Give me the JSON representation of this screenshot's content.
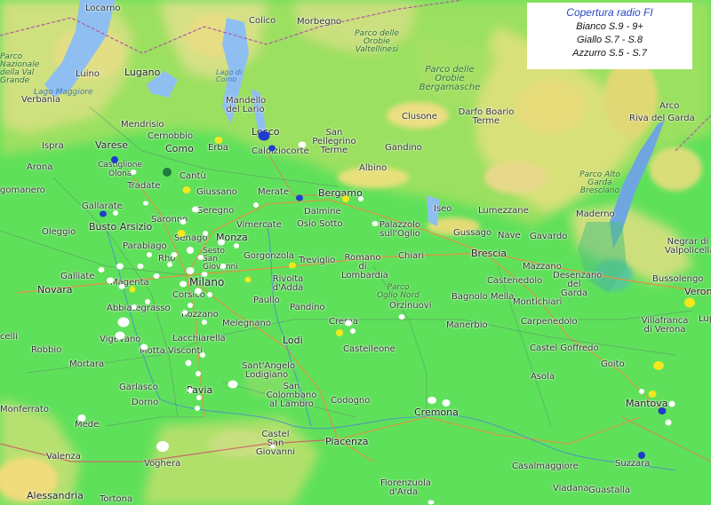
{
  "legend": {
    "title": "Copertura radio FI",
    "rows": [
      "Bianco S.9 - 9+",
      "Giallo  S.7 - S.8",
      "Azzurro S.5 - S.7"
    ]
  },
  "colors": {
    "coverage_base": "#5fe05a",
    "white_dot": "#ffffff",
    "yellow_dot": "#f3e71d",
    "blue_dot": "#1f3ccc",
    "lake": "#8fbff0"
  },
  "places": {
    "locarno": "Locarno",
    "lugano": "Lugano",
    "luino": "Luino",
    "verbania": "Verbania",
    "lago_maggiore": "Lago Maggiore",
    "parco_valgrande": "Parco Nazionale della Val Grande",
    "colico": "Colico",
    "morbegno": "Morbegno",
    "parco_orobie_valtellinesi": "Parco delle Orobie Valtellinesi",
    "parco_orobie_bergamasche": "Parco delle Orobie Bergamasche",
    "lago_como": "Lago di Como",
    "mandello": "Mandello del Lario",
    "mendrisio": "Mendrisio",
    "cernobbio": "Cernobbio",
    "como": "Como",
    "erba": "Erba",
    "lecco": "Lecco",
    "calolziocorte": "Calolziocorte",
    "san_pellegrino": "San Pellegrino Terme",
    "clusone": "Clusone",
    "darfo": "Darfo Boario Terme",
    "arco": "Arco",
    "riva": "Riva del Garda",
    "parco_alto_garda": "Parco Alto Garda Bresciano",
    "ispra": "Ispra",
    "varese": "Varese",
    "castiglione": "Castiglione",
    "arona": "Arona",
    "olona": "Olona",
    "tradate": "Tradate",
    "cantu": "Cantù",
    "giussano": "Giussano",
    "merate": "Merate",
    "bergamo": "Bergamo",
    "gandino": "Gandino",
    "albino": "Albino",
    "gomanero": "gomanero",
    "gallarate": "Gallarate",
    "busto": "Busto Arsizio",
    "saronno": "Saronno",
    "seregno": "Seregno",
    "dalmine": "Dalmine",
    "palazzolo": "Palazzolo sull'Oglio",
    "iseo": "Iseo",
    "lumezzane": "Lumezzane",
    "maderno": "Maderno",
    "oleggio": "Oleggio",
    "vimercate": "Vimercate",
    "osio": "Osio Sotto",
    "gussago": "Gussago",
    "nave": "Nave",
    "gavardo": "Gavardo",
    "negrar": "Negrar di Valpolicella",
    "monza": "Monza",
    "senago": "Senago",
    "sesto": "Sesto San Giovanni",
    "parabiago": "Parabiago",
    "rho": "Rho",
    "gorgonzola": "Gorgonzola",
    "treviglio": "Treviglio",
    "romano": "Romano di Lombardia",
    "chiari": "Chiari",
    "brescia": "Brescia",
    "mazzano": "Mazzano",
    "desenzano": "Desenzano del Garda",
    "bussolengo": "Bussolengo",
    "galliate": "Galliate",
    "novara": "Novara",
    "magenta": "Magenta",
    "rivolta": "Rivolta d'Adda",
    "castenedolo": "Castenedolo",
    "verona": "Verona",
    "milano": "Milano",
    "corsico": "Corsico",
    "parco_oglio_nord": "Parco Oglio Nord",
    "orzinuovi": "Orzinuovi",
    "bagnolo": "Bagnolo Mella",
    "montichiari": "Montichiari",
    "abbiategrasso": "Abbiategrasso",
    "paullo": "Paullo",
    "pandino": "Pandino",
    "crema": "Crema",
    "carpenedolo": "Carpenedolo",
    "villafranca": "Villafranca di Verona",
    "rozzano": "Rozzano",
    "melegnano": "Melegnano",
    "vercelli": "celli",
    "vigevano": "Vigevano",
    "lacchiarella": "Lacchiarella",
    "lodi": "Lodi",
    "manerbio": "Manerbio",
    "castel_goffredo": "Castel Goffredo",
    "robbio": "Robbio",
    "castelleone": "Castelleone",
    "mortara": "Mortara",
    "motta": "Motta Visconti",
    "santangelo": "Sant'Angelo Lodigiano",
    "goito": "Goito",
    "asola": "Asola",
    "garlasco": "Garlasco",
    "pavia": "Pavia",
    "san_colombano": "San Colombano al Lambro",
    "monferrato": "Monferrato",
    "dorno": "Dorno",
    "codogno": "Codogno",
    "cremona": "Cremona",
    "mantova": "Mantova",
    "mede": "Mede",
    "castel_san_giovanni": "Castel San Giovanni",
    "piacenza": "Piacenza",
    "casalmaggiore": "Casalmaggiore",
    "valenza": "Valenza",
    "voghera": "Voghera",
    "suzzara": "Suzzara",
    "fiorenzuola": "Fiorenzuola d'Arda",
    "viadana": "Viadana",
    "guastalla": "Guastalla",
    "alessandria": "Alessandria",
    "tortona": "Tortona",
    "lupa": "Lupa"
  }
}
